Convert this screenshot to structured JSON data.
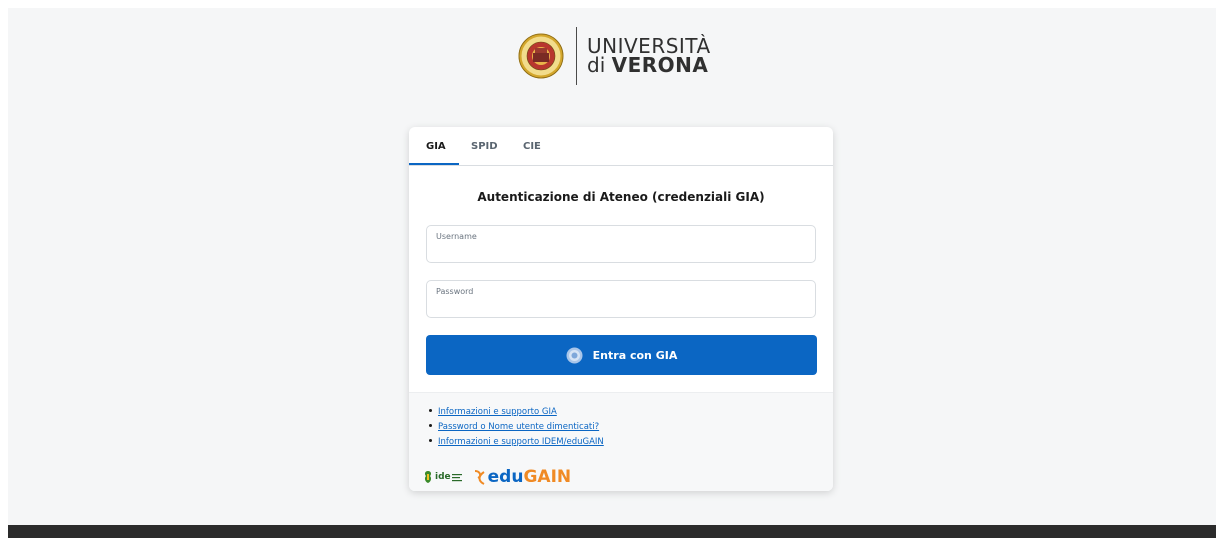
{
  "branding": {
    "logo_line1": "UNIVERSITÀ",
    "logo_line2_prefix": "di ",
    "logo_line2_bold": "VERONA",
    "seal_icon": "university-seal-icon",
    "accent_color": "#0b66c3"
  },
  "tabs": [
    {
      "label": "GIA",
      "active": true
    },
    {
      "label": "SPID",
      "active": false
    },
    {
      "label": "CIE",
      "active": false
    }
  ],
  "form": {
    "heading": "Autenticazione di Ateneo (credenziali GIA)",
    "username_label": "Username",
    "username_value": "",
    "password_label": "Password",
    "password_value": "",
    "submit_label": "Entra con GIA",
    "submit_icon": "university-seal-icon"
  },
  "links": [
    "Informazioni e supporto GIA",
    "Password o Nome utente dimenticati?",
    "Informazioni e supporto IDEM/eduGAIN"
  ],
  "federation_logos": {
    "idem_text": "ide",
    "edugain_edu": "edu",
    "edugain_gain": "GAIN"
  }
}
